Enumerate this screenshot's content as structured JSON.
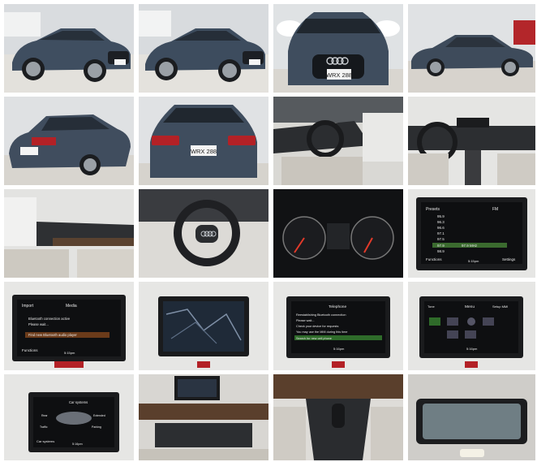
{
  "gallery": {
    "plate_text": "WRX 288",
    "radio": {
      "title": "Presets",
      "band": "FM",
      "freqs": [
        "95.9",
        "96.3",
        "96.6",
        "97.1",
        "97.5",
        "97.9",
        "98.9"
      ],
      "current": "97.9 MHz",
      "footer_left": "Functions",
      "footer_right": "Settings",
      "clock": "5:15pm"
    },
    "media": {
      "title": "Media",
      "tab": "Import",
      "line1": "Bluetooth connection active",
      "line2": "Please wait...",
      "line3": "Find new Bluetooth audio player",
      "footer_left": "Functions",
      "clock": "5:15pm"
    },
    "phone": {
      "title": "Telephone",
      "lines": [
        "Reestablishing Bluetooth connection",
        "Please wait...",
        "Check your device for requests",
        "You may use the MMI during this time",
        "Search for new cell phone"
      ],
      "clock": "5:16pm"
    },
    "menu": {
      "title": "Menu",
      "right_label": "Setup MMI",
      "left_label": "Tone",
      "clock": "5:16pm"
    },
    "camera": {
      "title": "Car systems",
      "modes": [
        "Rear",
        "Extended",
        "Traffic",
        "Parking"
      ],
      "footer_left": "Car systems",
      "clock": "5:16pm"
    }
  }
}
